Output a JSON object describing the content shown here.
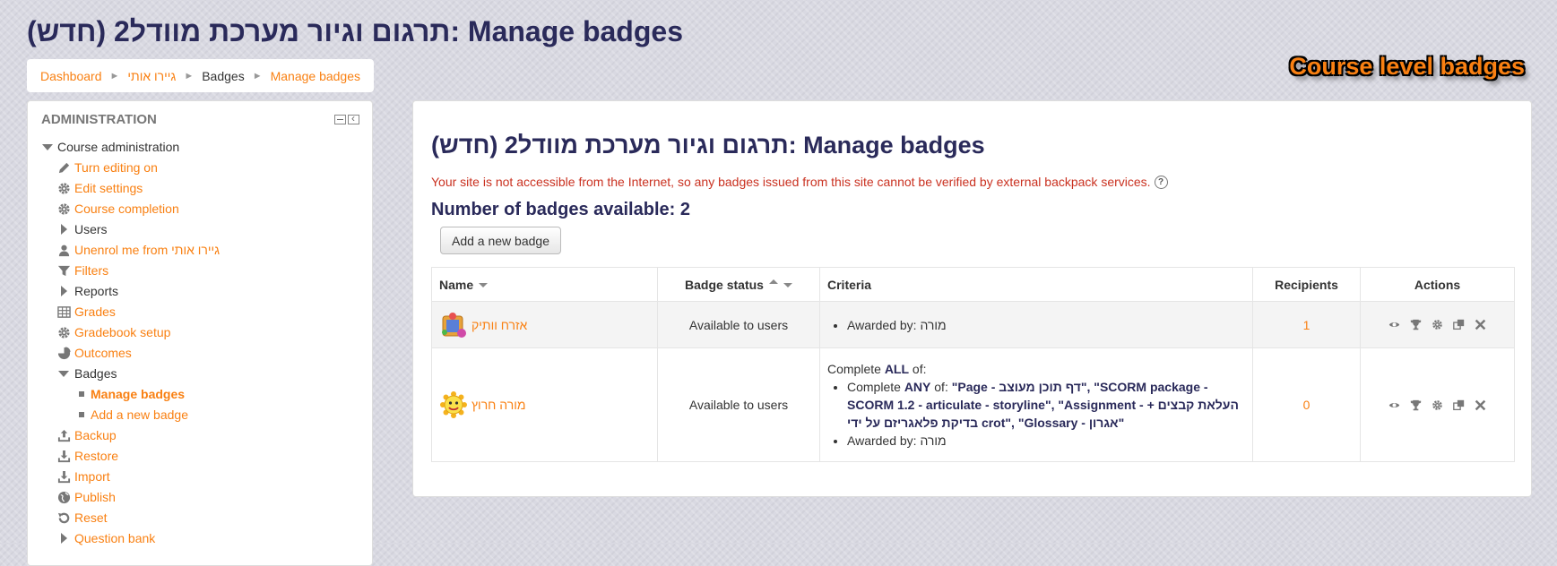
{
  "page": {
    "title": "(תרגום וגיור מערכת מוודל2 (חדש: Manage badges",
    "banner": "Course level badges"
  },
  "breadcrumb": {
    "items": [
      "Dashboard",
      "גיירו אותי",
      "Badges",
      "Manage badges"
    ],
    "separator": "►"
  },
  "sidebar": {
    "title": "ADMINISTRATION",
    "items": [
      {
        "label": "Course administration",
        "icon": "expanded-triangle-icon"
      },
      {
        "label": "Turn editing on",
        "icon": "pencil-icon"
      },
      {
        "label": "Edit settings",
        "icon": "gear-icon"
      },
      {
        "label": "Course completion",
        "icon": "gear-icon"
      },
      {
        "label": "Users",
        "icon": "collapsed-triangle-icon"
      },
      {
        "label": "Unenrol me from גיירו אותי",
        "icon": "user-icon"
      },
      {
        "label": "Filters",
        "icon": "funnel-icon"
      },
      {
        "label": "Reports",
        "icon": "collapsed-triangle-icon"
      },
      {
        "label": "Grades",
        "icon": "table-icon"
      },
      {
        "label": "Gradebook setup",
        "icon": "gear-icon"
      },
      {
        "label": "Outcomes",
        "icon": "pie-icon"
      },
      {
        "label": "Badges",
        "icon": "expanded-triangle-icon"
      },
      {
        "label": "Manage badges",
        "icon": "bullet-icon"
      },
      {
        "label": "Add a new badge",
        "icon": "bullet-icon"
      },
      {
        "label": "Backup",
        "icon": "upload-icon"
      },
      {
        "label": "Restore",
        "icon": "download-icon"
      },
      {
        "label": "Import",
        "icon": "download-icon"
      },
      {
        "label": "Publish",
        "icon": "globe-icon"
      },
      {
        "label": "Reset",
        "icon": "reset-icon"
      },
      {
        "label": "Question bank",
        "icon": "collapsed-triangle-icon"
      }
    ]
  },
  "main": {
    "heading": "(תרגום וגיור מערכת מוודל2 (חדש: Manage badges",
    "notice": "Your site is not accessible from the Internet, so any badges issued from this site cannot be verified by external backpack services.",
    "count": "Number of badges available: 2",
    "add_button": "Add a new badge",
    "table": {
      "headers": {
        "name": "Name",
        "status": "Badge status",
        "criteria": "Criteria",
        "recipients": "Recipients",
        "actions": "Actions"
      },
      "rows": [
        {
          "name": "אזרח וותיק",
          "status": "Available to users",
          "criteria_awarded": "Awarded by: מורה",
          "recipients": "1"
        },
        {
          "name": "מורה חרוץ",
          "status": "Available to users",
          "criteria_intro_pre": "Complete ",
          "criteria_intro_bold": "ALL",
          "criteria_intro_post": " of:",
          "criteria_line1_pre": "Complete ",
          "criteria_line1_bold": "ANY",
          "criteria_line1_post": " of: ",
          "criteria_items": "\"Page - דף תוכן מעוצב\", \"SCORM package - SCORM 1.2 - articulate - storyline\", \"Assignment - העלאת קבצים + בדיקת פלאגריזם על ידי crot\", \"Glossary - אגרון\"",
          "criteria_awarded": "Awarded by: מורה",
          "recipients": "0"
        }
      ]
    }
  },
  "colors": {
    "accent": "#f98012",
    "heading": "#2a2a5a",
    "notice": "#ca3120"
  }
}
